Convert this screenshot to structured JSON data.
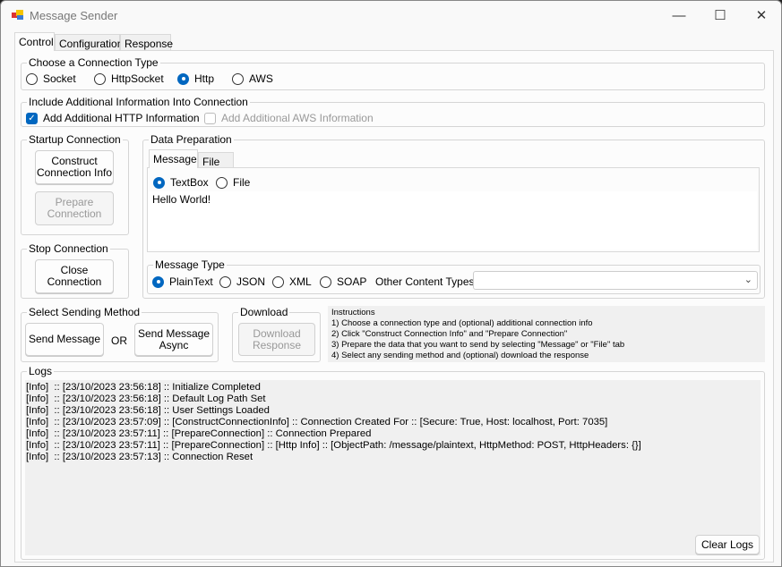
{
  "window": {
    "title": "Message Sender",
    "minimize": "—",
    "maximize": "☐",
    "close": "✕"
  },
  "tabs": [
    "Control",
    "Configuration",
    "Response"
  ],
  "connection_type": {
    "label": "Choose a Connection Type",
    "options": [
      "Socket",
      "HttpSocket",
      "Http",
      "AWS"
    ],
    "selected": "Http"
  },
  "additional_info": {
    "label": "Include Additional Information Into Connection",
    "http": {
      "label": "Add Additional HTTP Information",
      "checked": true
    },
    "aws": {
      "label": "Add Additional AWS Information",
      "checked": false,
      "enabled": false
    }
  },
  "startup": {
    "label": "Startup Connection",
    "construct": "Construct Connection Info",
    "prepare": "Prepare Connection"
  },
  "stop": {
    "label": "Stop Connection",
    "close": "Close Connection"
  },
  "data_prep": {
    "label": "Data Preparation",
    "tabs": [
      "Message",
      "File"
    ],
    "source_options": [
      "TextBox",
      "File"
    ],
    "source_selected": "TextBox",
    "text": "Hello World!"
  },
  "message_type": {
    "label": "Message Type",
    "options": [
      "PlainText",
      "JSON",
      "XML",
      "SOAP"
    ],
    "selected": "PlainText",
    "other_label": "Other Content Types",
    "other_value": ""
  },
  "sending": {
    "label": "Select Sending Method",
    "send": "Send Message",
    "or": "OR",
    "send_async": "Send Message Async"
  },
  "download": {
    "label": "Download",
    "button": "Download Response"
  },
  "instructions": [
    "Instructions",
    "1) Choose a connection type and (optional) additional connection info",
    "2) Click \"Construct Connection Info\" and \"Prepare Connection\"",
    "3) Prepare the data that you want to send by selecting \"Message\" or \"File\" tab",
    "4) Select any sending method and (optional) download the response"
  ],
  "logs": {
    "label": "Logs",
    "clear": "Clear Logs",
    "lines": [
      "[Info]  :: [23/10/2023 23:56:18] :: Initialize Completed",
      "[Info]  :: [23/10/2023 23:56:18] :: Default Log Path Set",
      "[Info]  :: [23/10/2023 23:56:18] :: User Settings Loaded",
      "[Info]  :: [23/10/2023 23:57:09] :: [ConstructConnectionInfo] :: Connection Created For :: [Secure: True, Host: localhost, Port: 7035]",
      "[Info]  :: [23/10/2023 23:57:11] :: [PrepareConnection] :: Connection Prepared",
      "[Info]  :: [23/10/2023 23:57:11] :: [PrepareConnection] :: [Http Info] :: [ObjectPath: /message/plaintext, HttpMethod: POST, HttpHeaders: {}]",
      "[Info]  :: [23/10/2023 23:57:13] :: Connection Reset"
    ]
  }
}
